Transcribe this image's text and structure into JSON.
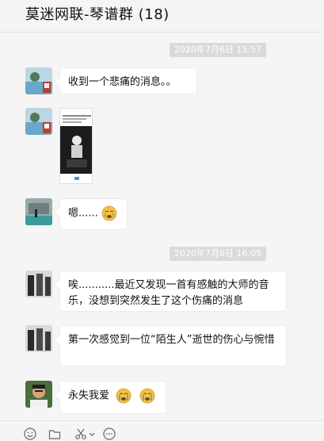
{
  "header": {
    "title": "莫迷网联-琴谱群 (18)"
  },
  "chat": {
    "time_1": "2020年7月6日  15:57",
    "time_2": "2020年7月6日  16:05",
    "messages": [
      {
        "text": "收到一个悲痛的消息。。"
      },
      {
        "type": "image"
      },
      {
        "text": "嗯......"
      },
      {
        "text": "唉...........最近又发现一首有感触的大师的音乐，没想到突然发生了这个伤痛的消息"
      },
      {
        "text": "第一次感觉到一位“陌生人”逝世的伤心与惋惜"
      },
      {
        "text": "永失我爱"
      }
    ]
  },
  "toolbar": {
    "icons": [
      "emoji-icon",
      "folder-icon",
      "scissors-icon",
      "more-icon"
    ]
  },
  "colors": {
    "background": "#f5f5f5",
    "bubble": "#ffffff",
    "time_pill": "#dadada"
  }
}
